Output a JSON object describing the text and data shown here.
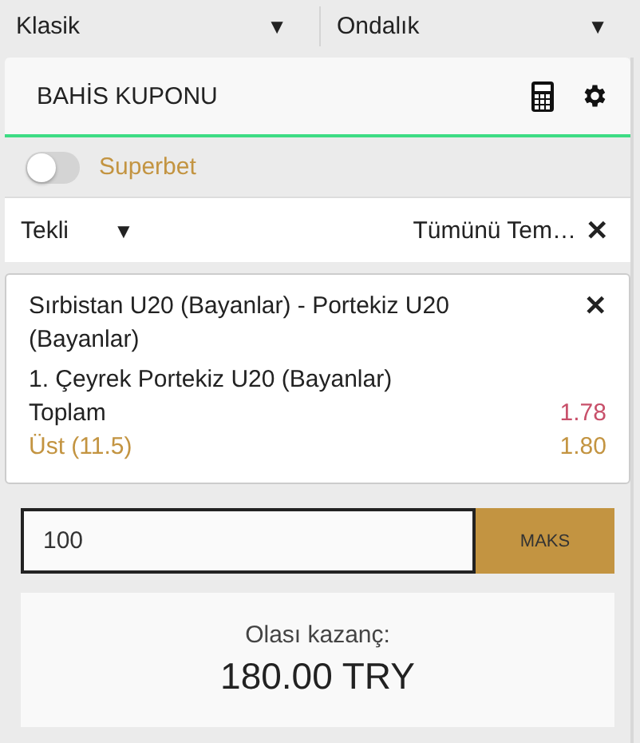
{
  "selectors": [
    {
      "label": "Klasik",
      "caret": "▼"
    },
    {
      "label": "Ondalık",
      "caret": "▼"
    }
  ],
  "header": {
    "title": "BAHİS KUPONU"
  },
  "superbet": {
    "label": "Superbet",
    "on": false
  },
  "bet_type": {
    "label": "Tekli",
    "caret": "▼",
    "clear_label": "Tümünü Tem…",
    "clear_icon": "✕"
  },
  "selection": {
    "event": "Sırbistan U20 (Bayanlar) - Portekiz U20 (Bayanlar)",
    "remove": "✕",
    "lines": [
      {
        "text": "1. Çeyrek Portekiz U20 (Bayanlar)",
        "kind": "plain"
      },
      {
        "text": "Toplam",
        "odds": "1.78",
        "kind": "old"
      },
      {
        "text": "Üst (11.5)",
        "odds": "1.80",
        "kind": "current"
      }
    ]
  },
  "stake": {
    "value": "100",
    "max_button": "MAKS"
  },
  "potential": {
    "label": "Olası kazanç:",
    "amount": "180.00 TRY"
  }
}
